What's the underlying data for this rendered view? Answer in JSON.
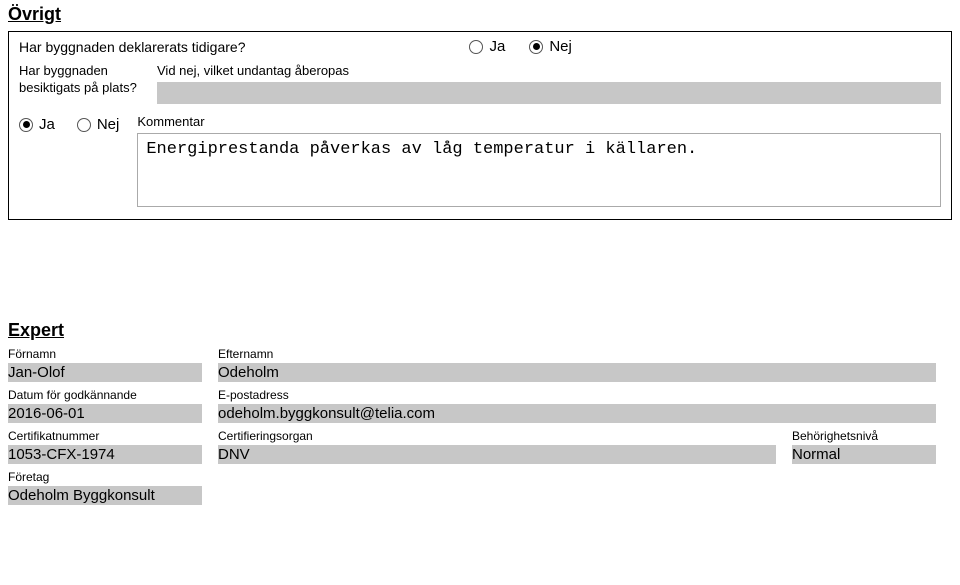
{
  "ovrigt": {
    "title": "Övrigt",
    "q1_label": "Har byggnaden deklarerats tidigare?",
    "q1_ja": "Ja",
    "q1_nej": "Nej",
    "q2_label": "Har byggnaden besiktigats på plats?",
    "undantag_label": "Vid nej, vilket undantag åberopas",
    "undantag_value": "",
    "r3_ja": "Ja",
    "r3_nej": "Nej",
    "kommentar_label": "Kommentar",
    "kommentar_value": "Energiprestanda påverkas av låg temperatur i källaren."
  },
  "expert": {
    "title": "Expert",
    "fornamn_label": "Förnamn",
    "fornamn_value": "Jan-Olof",
    "efternamn_label": "Efternamn",
    "efternamn_value": "Odeholm",
    "datum_label": "Datum för godkännande",
    "datum_value": "2016-06-01",
    "epost_label": "E-postadress",
    "epost_value": "odeholm.byggkonsult@telia.com",
    "cert_label": "Certifikatnummer",
    "cert_value": "1053-CFX-1974",
    "organ_label": "Certifieringsorgan",
    "organ_value": "DNV",
    "niva_label": "Behörighetsnivå",
    "niva_value": "Normal",
    "foretag_label": "Företag",
    "foretag_value": "Odeholm Byggkonsult"
  }
}
